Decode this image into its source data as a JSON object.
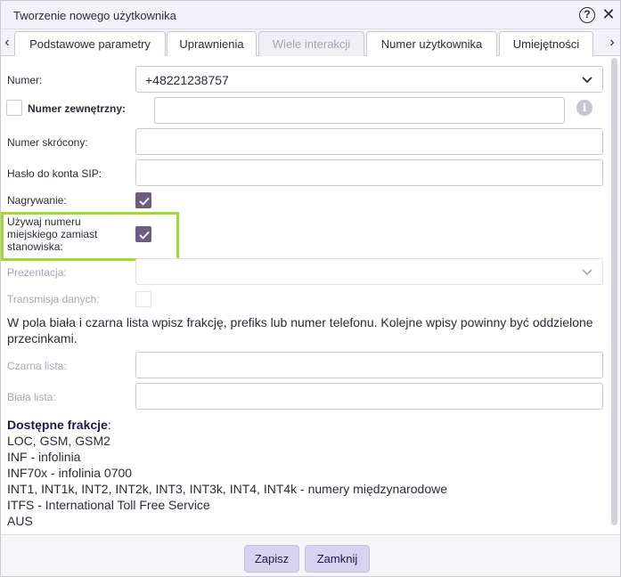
{
  "dialog": {
    "title": "Tworzenie nowego użytkownika",
    "help_icon": "?",
    "close_icon": "✕"
  },
  "tabs": [
    {
      "label": "Podstawowe parametry",
      "state": "normal"
    },
    {
      "label": "Uprawnienia",
      "state": "normal"
    },
    {
      "label": "Wiele interakcji",
      "state": "disabled"
    },
    {
      "label": "Numer użytkownika",
      "state": "normal"
    },
    {
      "label": "Umiejętności",
      "state": "normal"
    }
  ],
  "tab_nav": {
    "left": "‹",
    "right": "›"
  },
  "form": {
    "numer_label": "Numer:",
    "numer_value": "+48221238757",
    "numer_zew_label": "Numer zewnętrzny:",
    "numer_zew_value": "",
    "numer_skrocony_label": "Numer skrócony:",
    "numer_skrocony_value": "",
    "haslo_label": "Hasło do konta SIP:",
    "haslo_value": "",
    "nagrywanie_label": "Nagrywanie:",
    "nagrywanie_checked": true,
    "uzywaj_label_1": "Używaj numeru",
    "uzywaj_label_2": "miejskiego zamiast",
    "uzywaj_label_3": "stanowiska:",
    "uzywaj_checked": true,
    "prezentacja_label": "Prezentacja:",
    "prezentacja_value": "",
    "transmisja_label": "Transmisja danych:",
    "transmisja_checked": false,
    "info_text": "W pola biała i czarna lista wpisz frakcję, prefiks lub numer telefonu. Kolejne wpisy powinny być oddzielone przecinkami.",
    "czarna_label": "Czarna lista:",
    "czarna_value": "",
    "biala_label": "Biała lista:",
    "biala_value": ""
  },
  "fractions": {
    "title": "Dostępne frakcje",
    "title_suffix": ":",
    "lines": [
      "LOC, GSM, GSM2",
      "INF - infolinia",
      "INF70x - infolinia 0700",
      "INT1, INT1k, INT2, INT2k, INT3, INT3k, INT4, INT4k - numery międzynarodowe",
      "ITFS - International Toll Free Service",
      "AUS"
    ]
  },
  "footer": {
    "save_label": "Zapisz",
    "close_label": "Zamknij"
  },
  "colors": {
    "accent_checkbox": "#6b5e80",
    "highlight_border": "#9fdc2e",
    "button_bg": "#d6d2f0"
  }
}
